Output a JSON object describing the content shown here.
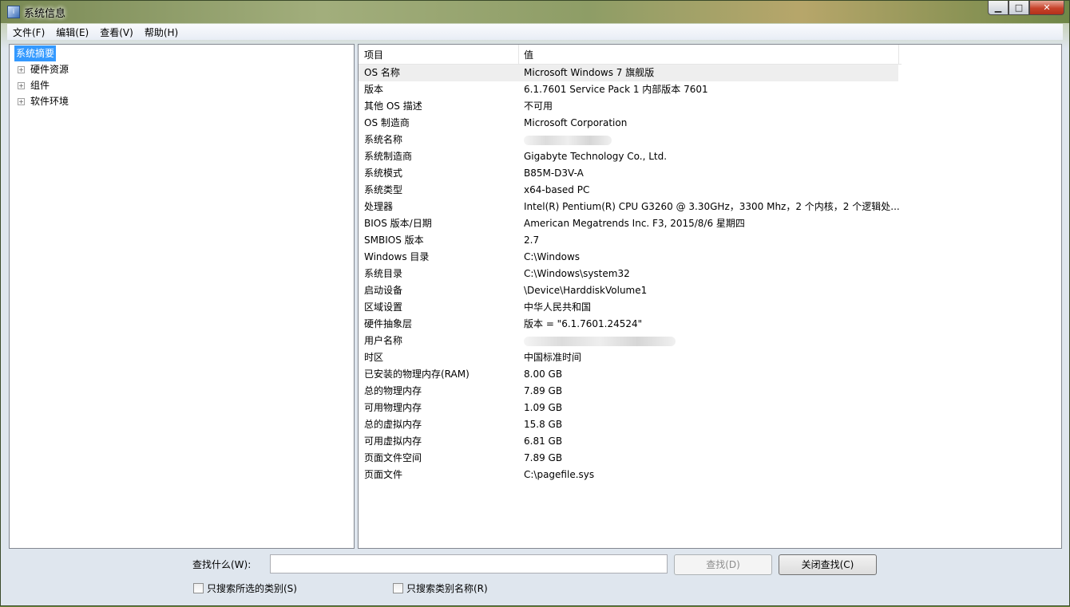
{
  "window": {
    "title": "系统信息"
  },
  "menu": [
    "文件(F)",
    "编辑(E)",
    "查看(V)",
    "帮助(H)"
  ],
  "tree": {
    "root": "系统摘要",
    "children": [
      "硬件资源",
      "组件",
      "软件环境"
    ]
  },
  "detail": {
    "columns": [
      "项目",
      "值"
    ],
    "rows": [
      {
        "k": "OS 名称",
        "v": "Microsoft Windows 7 旗舰版"
      },
      {
        "k": "版本",
        "v": "6.1.7601 Service Pack 1 内部版本 7601"
      },
      {
        "k": "其他 OS 描述",
        "v": "不可用"
      },
      {
        "k": "OS 制造商",
        "v": "Microsoft Corporation"
      },
      {
        "k": "系统名称",
        "v": ""
      },
      {
        "k": "系统制造商",
        "v": "Gigabyte Technology Co., Ltd."
      },
      {
        "k": "系统模式",
        "v": "B85M-D3V-A"
      },
      {
        "k": "系统类型",
        "v": "x64-based PC"
      },
      {
        "k": "处理器",
        "v": "Intel(R) Pentium(R) CPU G3260 @ 3.30GHz，3300 Mhz，2 个内核，2 个逻辑处..."
      },
      {
        "k": "BIOS 版本/日期",
        "v": "American Megatrends Inc. F3, 2015/8/6 星期四"
      },
      {
        "k": "SMBIOS 版本",
        "v": "2.7"
      },
      {
        "k": "Windows 目录",
        "v": "C:\\Windows"
      },
      {
        "k": "系统目录",
        "v": "C:\\Windows\\system32"
      },
      {
        "k": "启动设备",
        "v": "\\Device\\HarddiskVolume1"
      },
      {
        "k": "区域设置",
        "v": "中华人民共和国"
      },
      {
        "k": "硬件抽象层",
        "v": "版本 = \"6.1.7601.24524\""
      },
      {
        "k": "用户名称",
        "v": ""
      },
      {
        "k": "时区",
        "v": "中国标准时间"
      },
      {
        "k": "已安装的物理内存(RAM)",
        "v": "8.00 GB"
      },
      {
        "k": "总的物理内存",
        "v": "7.89 GB"
      },
      {
        "k": "可用物理内存",
        "v": "1.09 GB"
      },
      {
        "k": "总的虚拟内存",
        "v": "15.8 GB"
      },
      {
        "k": "可用虚拟内存",
        "v": "6.81 GB"
      },
      {
        "k": "页面文件空间",
        "v": "7.89 GB"
      },
      {
        "k": "页面文件",
        "v": "C:\\pagefile.sys"
      }
    ]
  },
  "find": {
    "label": "查找什么(W):",
    "value": "",
    "find_button": "查找(D)",
    "close_button": "关闭查找(C)",
    "check1": "只搜索所选的类别(S)",
    "check2": "只搜索类别名称(R)"
  }
}
